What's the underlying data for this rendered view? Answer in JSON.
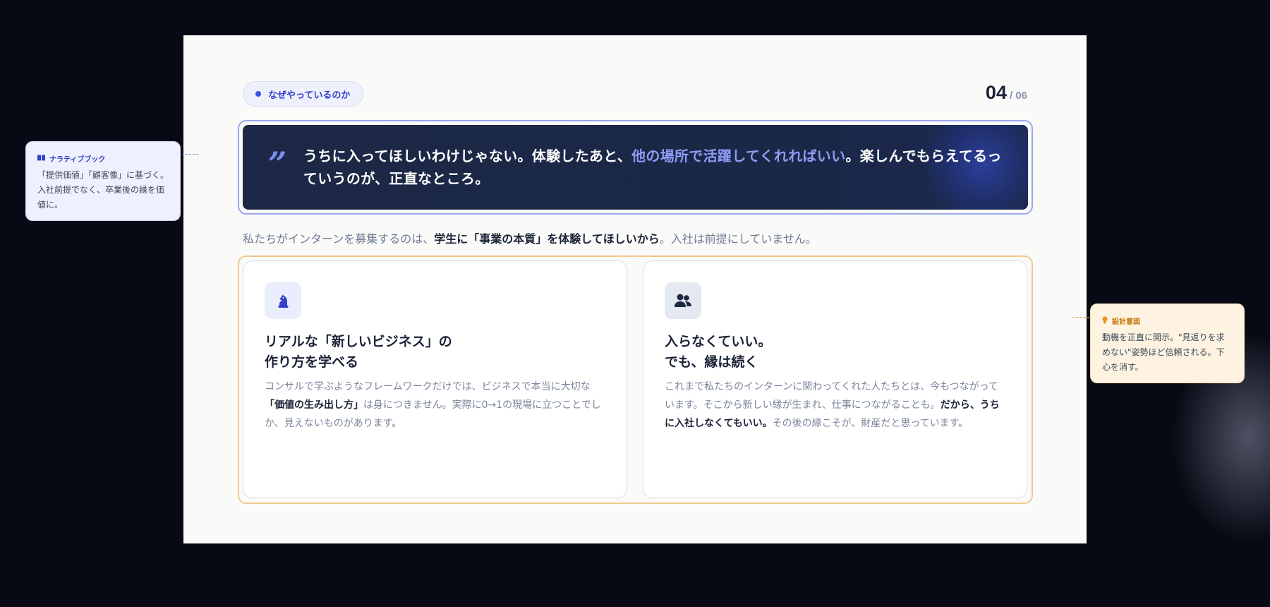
{
  "slide": {
    "section_tag": "なぜやっているのか",
    "page_current": "04",
    "page_total": "/ 06",
    "quote": {
      "mark": "”",
      "text_before": "うちに入ってほしいわけじゃない。体験したあと、",
      "text_highlight": "他の場所で活躍してくれればいい",
      "text_after": "。楽しんでもらえてるっていうのが、正直なところ。"
    },
    "lead": {
      "before": "私たちがインターンを募集するのは、",
      "strong": "学生に「事業の本質」を体験してほしいから",
      "after": "。入社は前提にしていません。"
    },
    "cards": [
      {
        "icon": "chess-knight-icon",
        "title_line1": "リアルな「新しいビジネス」の",
        "title_line2": "作り方を学べる",
        "body_before": "コンサルで学ぶようなフレームワークだけでは、ビジネスで本当に大切な",
        "body_strong": "「価値の生み出し方」",
        "body_after": "は身につきません。実際に0→1の現場に立つことでしか、見えないものがあります。"
      },
      {
        "icon": "users-icon",
        "title_line1": "入らなくていい。",
        "title_line2": "でも、縁は続く",
        "body_before": "これまで私たちのインターンに関わってくれた人たちとは、今もつながっています。そこから新しい縁が生まれ、仕事につながることも。",
        "body_strong": "だから、うちに入社しなくてもいい。",
        "body_after": "その後の縁こそが、財産だと思っています。"
      }
    ]
  },
  "annotations": {
    "narrative": {
      "icon": "book-icon",
      "title": "ナラティブブック",
      "body": "「提供価値」「顧客像」に基づく。入社前提でなく、卒業後の縁を価値に。"
    },
    "design_intent": {
      "icon": "lightbulb-icon",
      "title": "設計意図",
      "body": "動機を正直に開示。\"見返りを求めない\"姿勢ほど信頼される。下心を消す。"
    }
  },
  "colors": {
    "accent": "#3b4fe0",
    "quote_bg": "#1c2845",
    "highlight": "#8f9cf6",
    "warm_border": "#f0c98f"
  }
}
